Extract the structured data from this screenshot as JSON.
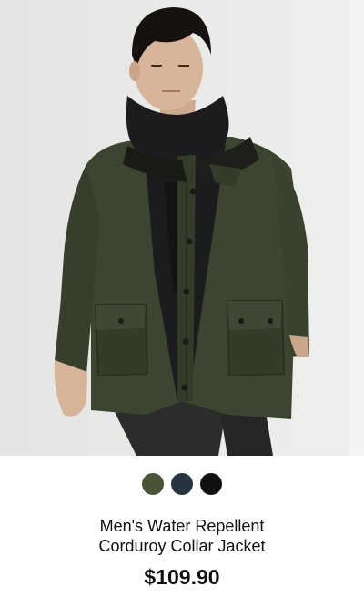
{
  "product": {
    "image_alt": "Man wearing olive green water repellent jacket with corduroy collar over black hoodie",
    "colors": [
      {
        "name": "olive",
        "hex": "#4a5338"
      },
      {
        "name": "navy",
        "hex": "#263340"
      },
      {
        "name": "black",
        "hex": "#111111"
      }
    ],
    "title_line1": "Men's Water Repellent",
    "title_line2": "Corduroy Collar Jacket",
    "price": "$109.90"
  }
}
